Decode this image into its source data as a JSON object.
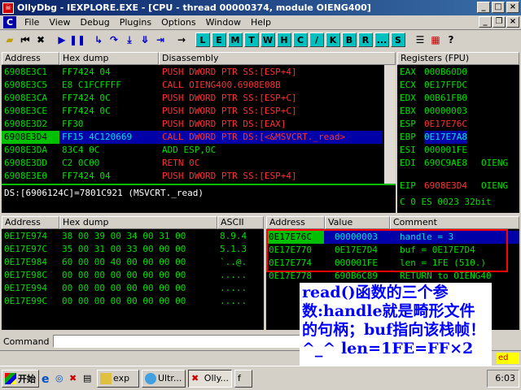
{
  "window": {
    "title": "OllyDbg - IEXPLORE.EXE - [CPU - thread 00000374, module OIENG400]"
  },
  "menu": [
    "File",
    "View",
    "Debug",
    "Plugins",
    "Options",
    "Window",
    "Help"
  ],
  "toolbar_letters": [
    "L",
    "E",
    "M",
    "T",
    "W",
    "H",
    "C",
    "/",
    "K",
    "B",
    "R",
    "...",
    "S"
  ],
  "disasm": {
    "headers": {
      "address": "Address",
      "hex": "Hex dump",
      "disasm": "Disassembly"
    },
    "rows": [
      {
        "addr": "6908E3C1",
        "hex": "FF7424 04",
        "ins": "PUSH DWORD PTR SS:[ESP+4]",
        "color": "red"
      },
      {
        "addr": "6908E3C5",
        "hex": "E8 C1FCFFFF",
        "ins": "CALL OIENG400.6908E08B",
        "color": "red"
      },
      {
        "addr": "6908E3CA",
        "hex": "FF7424 0C",
        "ins": "PUSH DWORD PTR SS:[ESP+C]",
        "color": "red"
      },
      {
        "addr": "6908E3CE",
        "hex": "FF7424 0C",
        "ins": "PUSH DWORD PTR SS:[ESP+C]",
        "color": "red"
      },
      {
        "addr": "6908E3D2",
        "hex": "FF30",
        "ins": "PUSH DWORD PTR DS:[EAX]",
        "color": "red"
      },
      {
        "addr": "6908E3D4",
        "hex": "FF15 4C120669",
        "ins": "CALL DWORD PTR DS:[<&MSVCRT._read>",
        "color": "red"
      },
      {
        "addr": "6908E3DA",
        "hex": "83C4 0C",
        "ins": "ADD ESP,0C",
        "color": "green"
      },
      {
        "addr": "6908E3DD",
        "hex": "C2 0C00",
        "ins": "RETN 0C",
        "color": "red"
      },
      {
        "addr": "6908E3E0",
        "hex": "FF7424 04",
        "ins": "PUSH DWORD PTR SS:[ESP+4]",
        "color": "red"
      }
    ],
    "info": "DS:[6906124C]=7801C921 (MSVCRT._read)"
  },
  "registers": {
    "header": "Registers (FPU)",
    "rows": [
      {
        "name": "EAX",
        "val": "000B60D0",
        "extra": "",
        "color": "green"
      },
      {
        "name": "ECX",
        "val": "0E17FFDC",
        "extra": "",
        "color": "green"
      },
      {
        "name": "EDX",
        "val": "00B61FB0",
        "extra": "",
        "color": "green"
      },
      {
        "name": "EBX",
        "val": "00000003",
        "extra": "",
        "color": "green"
      },
      {
        "name": "ESP",
        "val": "0E17E76C",
        "extra": "",
        "color": "red"
      },
      {
        "name": "EBP",
        "val": "0E17E7A8",
        "extra": "",
        "color": "cyan"
      },
      {
        "name": "ESI",
        "val": "000001FE",
        "extra": "",
        "color": "green"
      },
      {
        "name": "EDI",
        "val": "690C9AE8",
        "extra": "OIENG",
        "color": "green"
      }
    ],
    "eip": {
      "name": "EIP",
      "val": "6908E3D4",
      "extra": "OIENG"
    },
    "flags": "C 0  ES 0023 32bit"
  },
  "dump": {
    "headers": {
      "address": "Address",
      "hex": "Hex dump",
      "ascii": "ASCII"
    },
    "rows": [
      {
        "addr": "0E17E974",
        "hex": "38 00 39 00 34 00 31 00",
        "ascii": "8.9.4"
      },
      {
        "addr": "0E17E97C",
        "hex": "35 00 31 00 33 00 00 00",
        "ascii": "5.1.3"
      },
      {
        "addr": "0E17E984",
        "hex": "60 00 00 40 00 00 00 00",
        "ascii": "`..@."
      },
      {
        "addr": "0E17E98C",
        "hex": "00 00 00 00 00 00 00 00",
        "ascii": "....."
      },
      {
        "addr": "0E17E994",
        "hex": "00 00 00 00 00 00 00 00",
        "ascii": "....."
      },
      {
        "addr": "0E17E99C",
        "hex": "00 00 00 00 00 00 00 00",
        "ascii": "....."
      }
    ]
  },
  "stack": {
    "headers": {
      "address": "Address",
      "value": "Value",
      "comment": "Comment"
    },
    "rows": [
      {
        "addr": "0E17E76C",
        "val": "00000003",
        "comment": "handle = 3"
      },
      {
        "addr": "0E17E770",
        "val": "0E17E7D4",
        "comment": "buf = 0E17E7D4"
      },
      {
        "addr": "0E17E774",
        "val": "000001FE",
        "comment": "len = 1FE (510.)"
      },
      {
        "addr": "0E17E778",
        "val": "690B6C89",
        "comment": "RETURN to OIENG40"
      }
    ]
  },
  "annotation": "read()函数的三个参数:handle就是畸形文件的句柄；buf指向该栈帧！^_^ len=1FE=FF×2",
  "command": {
    "label": "Command"
  },
  "taskbar": {
    "start": "开始",
    "tasks": [
      "exp",
      "Ultr...",
      "Olly...",
      "f"
    ],
    "clock": "6:03",
    "status": "ed"
  }
}
